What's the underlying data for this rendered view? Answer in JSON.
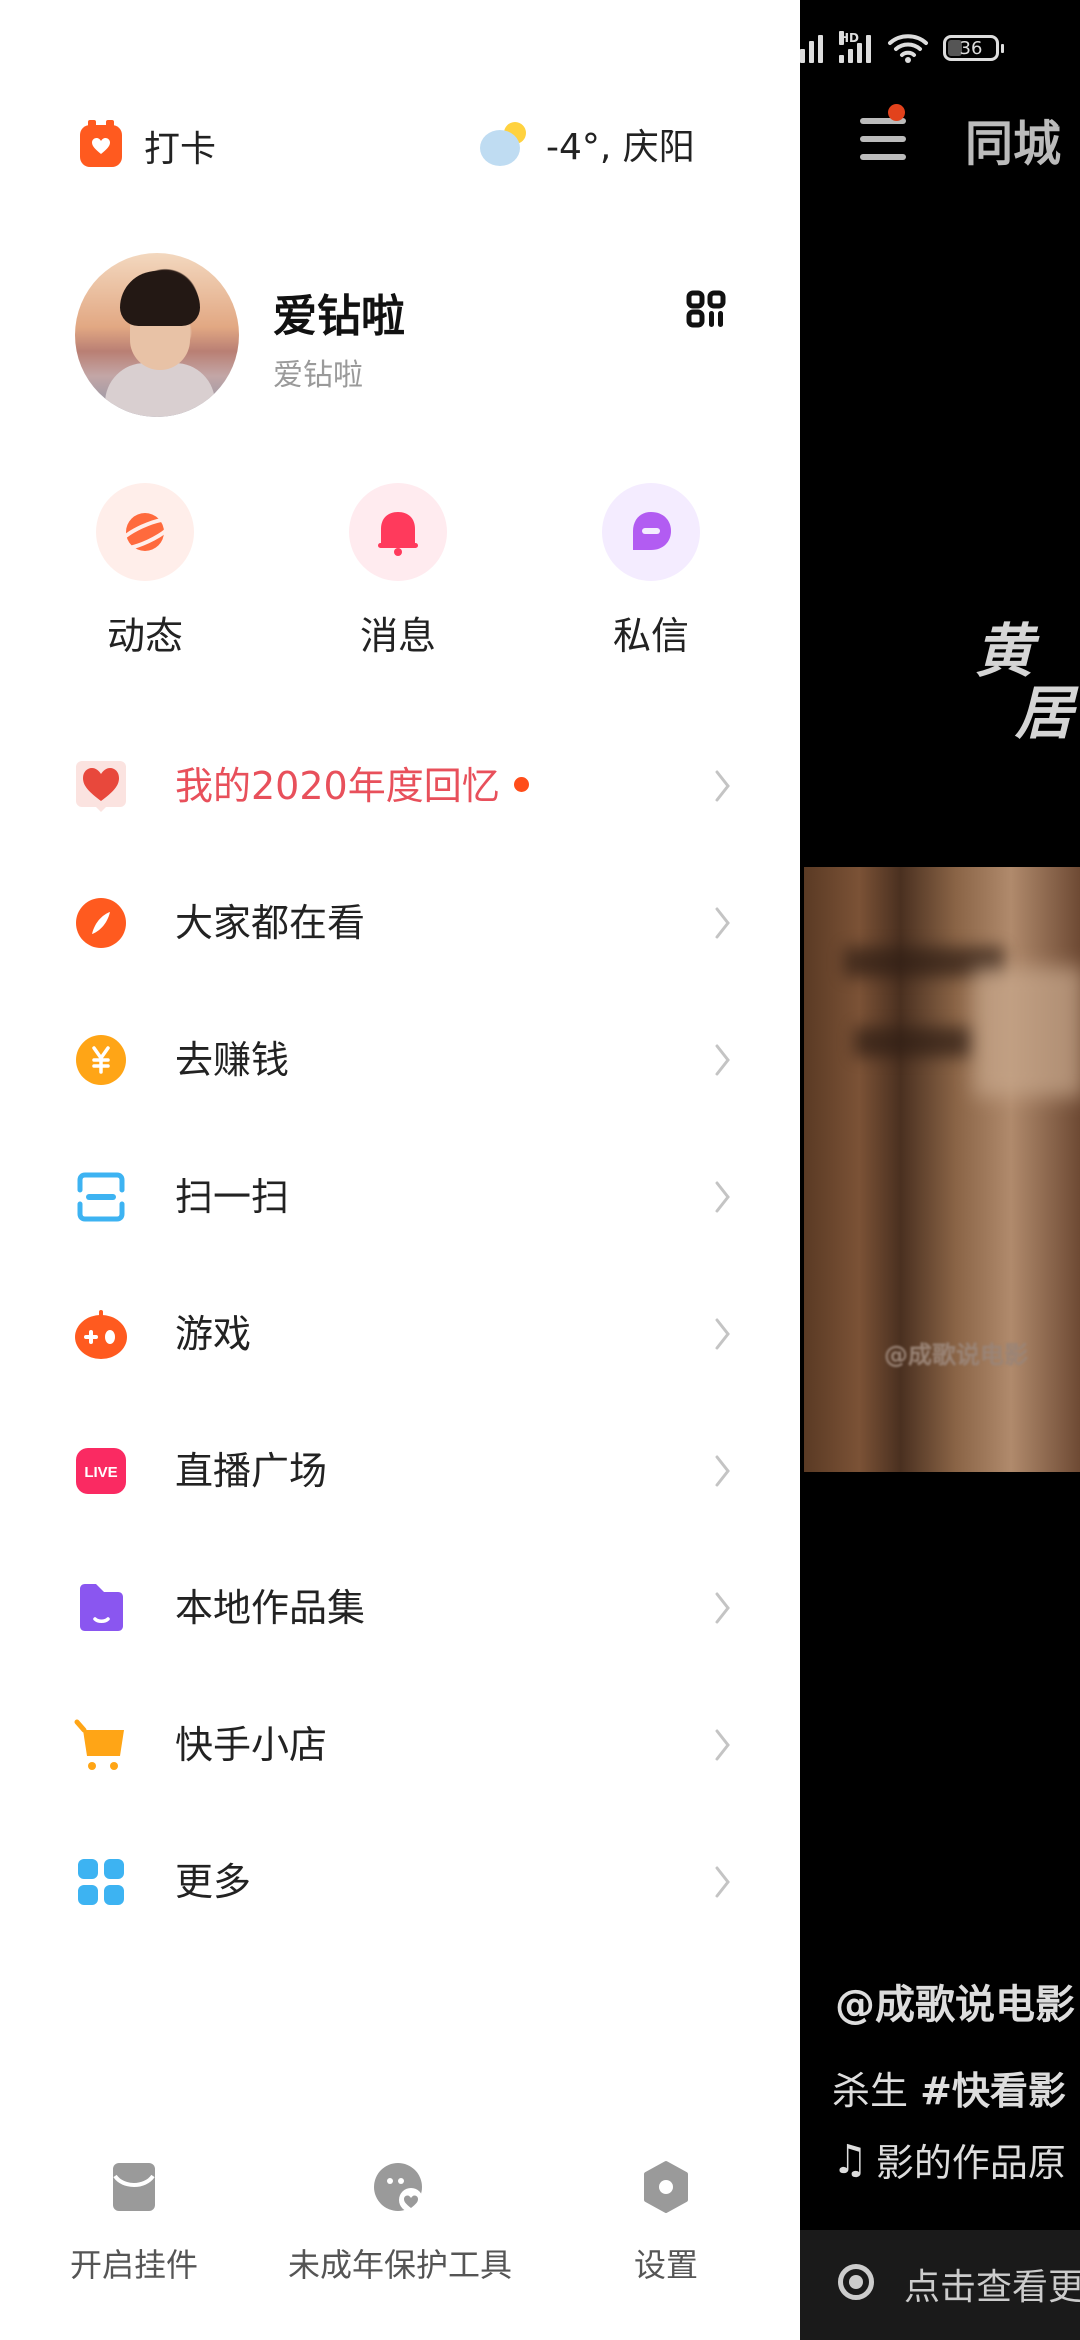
{
  "header": {
    "punch_label": "打卡",
    "weather_label": "-4°, 庆阳"
  },
  "profile": {
    "name": "爱钻啦",
    "user_id": "爱钻啦"
  },
  "quick_actions": [
    {
      "label": "动态",
      "icon": "planet-icon",
      "color": "#ff6a3d"
    },
    {
      "label": "消息",
      "icon": "bell-icon",
      "color": "#ff3a5c"
    },
    {
      "label": "私信",
      "icon": "chat-bubble-icon",
      "color": "#b25cf2"
    }
  ],
  "menu": [
    {
      "label": "我的2020年度回忆",
      "icon": "heart-memory-icon",
      "highlight": true,
      "has_dot": true,
      "text_color": "#e8505b"
    },
    {
      "label": "大家都在看",
      "icon": "compass-icon",
      "color": "#ff5a1f"
    },
    {
      "label": "去赚钱",
      "icon": "yuan-coin-icon",
      "color": "#ffa516"
    },
    {
      "label": "扫一扫",
      "icon": "scan-icon",
      "color": "#3db3f2"
    },
    {
      "label": "游戏",
      "icon": "gamepad-icon",
      "color": "#ff5a1f"
    },
    {
      "label": "直播广场",
      "icon": "live-icon",
      "color": "#fa2a62",
      "icon_text": "LIVE"
    },
    {
      "label": "本地作品集",
      "icon": "folder-icon",
      "color": "#8a56f0"
    },
    {
      "label": "快手小店",
      "icon": "cart-icon",
      "color": "#ffa516"
    },
    {
      "label": "更多",
      "icon": "grid-more-icon",
      "color": "#3db3f2"
    }
  ],
  "bottom": [
    {
      "label": "开启挂件",
      "icon": "widget-icon"
    },
    {
      "label": "未成年保护工具",
      "icon": "minor-protection-icon"
    },
    {
      "label": "设置",
      "icon": "settings-icon"
    }
  ],
  "status_bar": {
    "battery": "36",
    "network_badge": "HD"
  },
  "feed": {
    "tab_label": "同城",
    "video_title_line1": "黄",
    "video_title_line2": "居",
    "watermark": "@成歌说电影",
    "author": "@成歌说电影",
    "desc_prefix": "杀生 ",
    "desc_tag": "#快看影",
    "music": "影的作品原",
    "bottom_prompt": "点击查看更多"
  }
}
